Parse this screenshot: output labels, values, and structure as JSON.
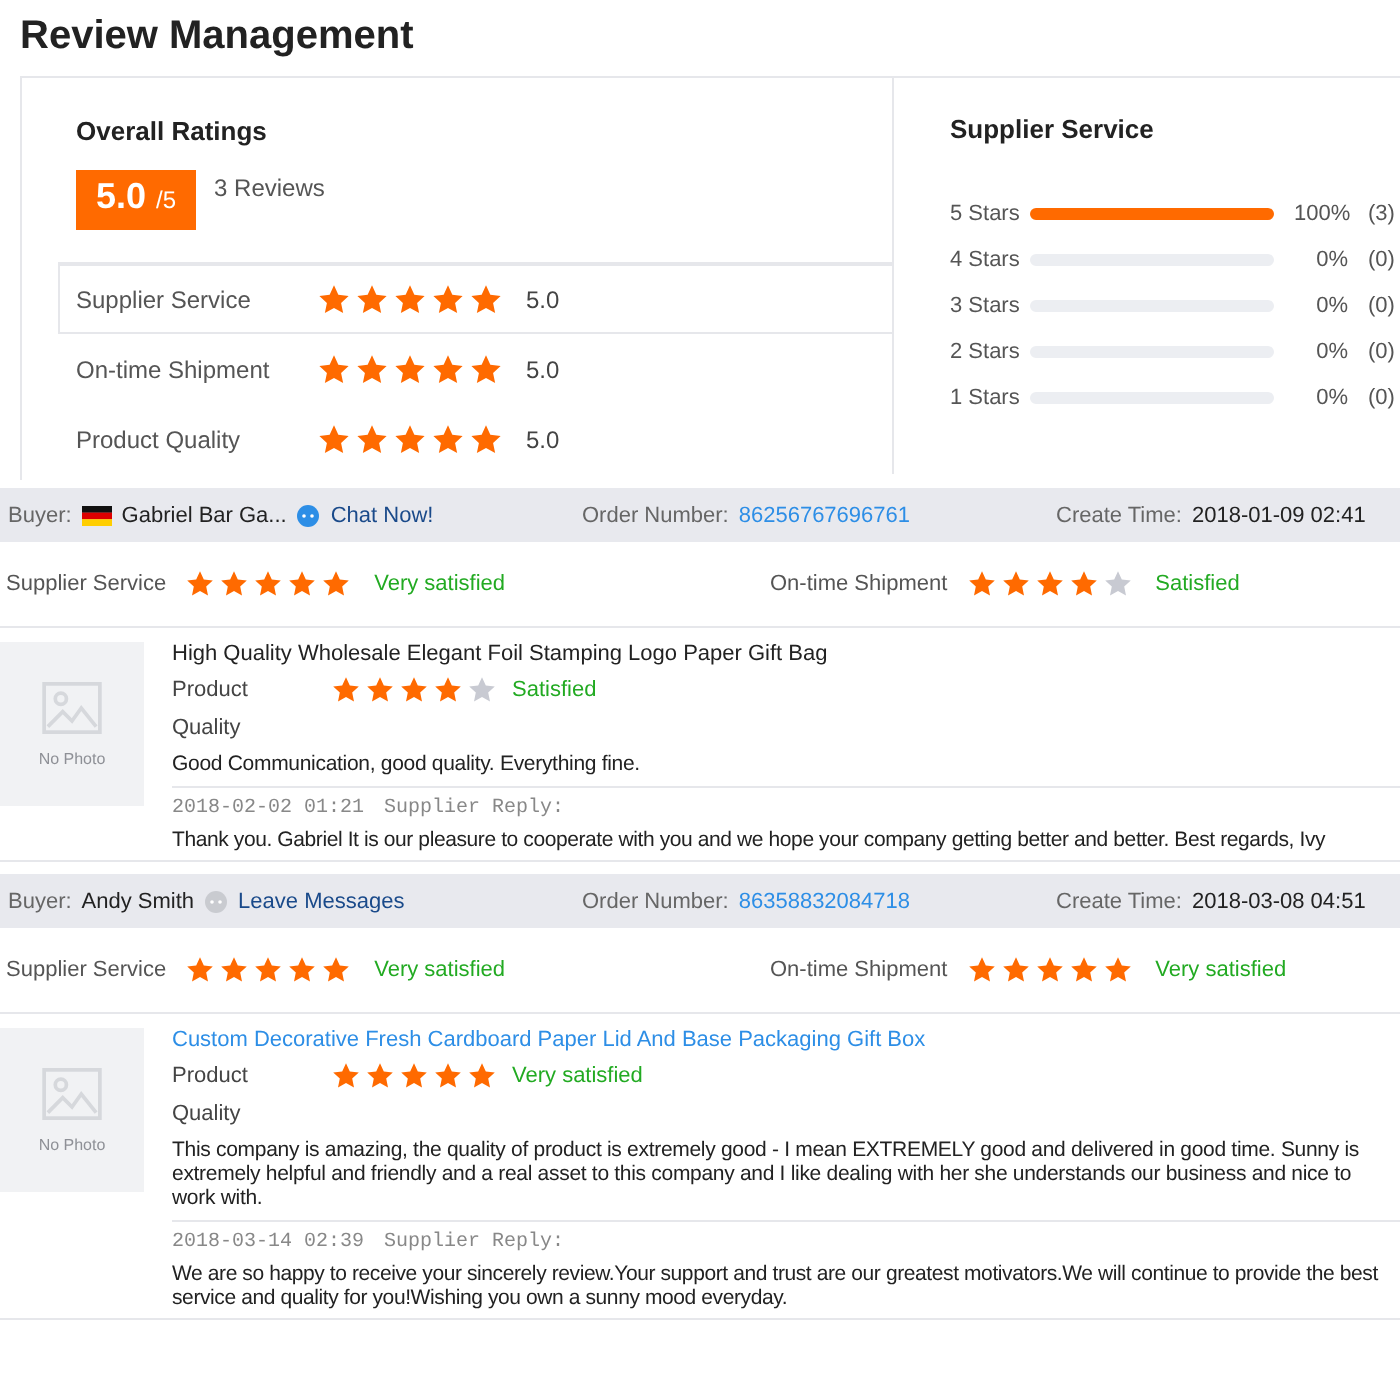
{
  "title": "Review Management",
  "overall": {
    "heading": "Overall Ratings",
    "score": "5.0",
    "out_of": "/5",
    "count": "3 Reviews",
    "criteria": [
      {
        "label": "Supplier Service",
        "stars": 5,
        "value": "5.0"
      },
      {
        "label": "On-time Shipment",
        "stars": 5,
        "value": "5.0"
      },
      {
        "label": "Product Quality",
        "stars": 5,
        "value": "5.0"
      }
    ]
  },
  "distribution": {
    "heading": "Supplier Service",
    "rows": [
      {
        "label": "5 Stars",
        "level": 1,
        "percent": "100%",
        "count": "(3)"
      },
      {
        "label": "4 Stars",
        "level": 0,
        "percent": "0%",
        "count": "(0)"
      },
      {
        "label": "3 Stars",
        "level": 0,
        "percent": "0%",
        "count": "(0)"
      },
      {
        "label": "2 Stars",
        "level": 0,
        "percent": "0%",
        "count": "(0)"
      },
      {
        "label": "1 Stars",
        "level": 0,
        "percent": "0%",
        "count": "(0)"
      }
    ]
  },
  "reviews": [
    {
      "buyer_label": "Buyer:",
      "has_flag": true,
      "buyer_name": "Gabriel Bar Ga...",
      "contact": {
        "label": "Chat Now!",
        "online": true
      },
      "order_label": "Order Number:",
      "order_number": "86256767696761",
      "time_label": "Create Time:",
      "time": "2018-01-09 02:41",
      "ratings": [
        {
          "label": "Supplier Service",
          "stars": 5,
          "verdict": "Very satisfied"
        },
        {
          "label": "On-time Shipment",
          "stars": 4,
          "verdict": "Satisfied"
        }
      ],
      "product": {
        "photo_label": "No Photo",
        "title": "High Quality Wholesale Elegant Foil Stamping Logo Paper Gift Bag",
        "link": false,
        "product_label": "Product",
        "stars": 4,
        "verdict": "Satisfied",
        "quality_label": "Quality",
        "comment": "Good Communication, good quality. Everything fine."
      },
      "reply": {
        "time": "2018-02-02 01:21",
        "label": "Supplier Reply:",
        "text": "Thank you. Gabriel It is our pleasure to cooperate with you and we hope your company getting better and better. Best regards, Ivy"
      }
    },
    {
      "buyer_label": "Buyer:",
      "has_flag": false,
      "buyer_name": "Andy Smith",
      "contact": {
        "label": "Leave Messages",
        "online": false
      },
      "order_label": "Order Number:",
      "order_number": "86358832084718",
      "time_label": "Create Time:",
      "time": "2018-03-08 04:51",
      "ratings": [
        {
          "label": "Supplier Service",
          "stars": 5,
          "verdict": "Very satisfied"
        },
        {
          "label": "On-time Shipment",
          "stars": 5,
          "verdict": "Very satisfied"
        }
      ],
      "product": {
        "photo_label": "No Photo",
        "title": "Custom Decorative Fresh Cardboard Paper Lid And Base Packaging Gift Box",
        "link": true,
        "product_label": "Product",
        "stars": 5,
        "verdict": "Very satisfied",
        "quality_label": "Quality",
        "comment": "This company is amazing, the quality of product is extremely good - I mean EXTREMELY good and delivered in good time. Sunny is extremely helpful and friendly and a real asset to this company and I like dealing with her she understands our business and nice to work with."
      },
      "reply": {
        "time": "2018-03-14 02:39",
        "label": "Supplier Reply:",
        "text": "We are so happy to receive your sincerely review.Your support and trust are our greatest motivators.We will continue to provide the best service and quality for you!Wishing you own a sunny mood everyday."
      }
    }
  ]
}
